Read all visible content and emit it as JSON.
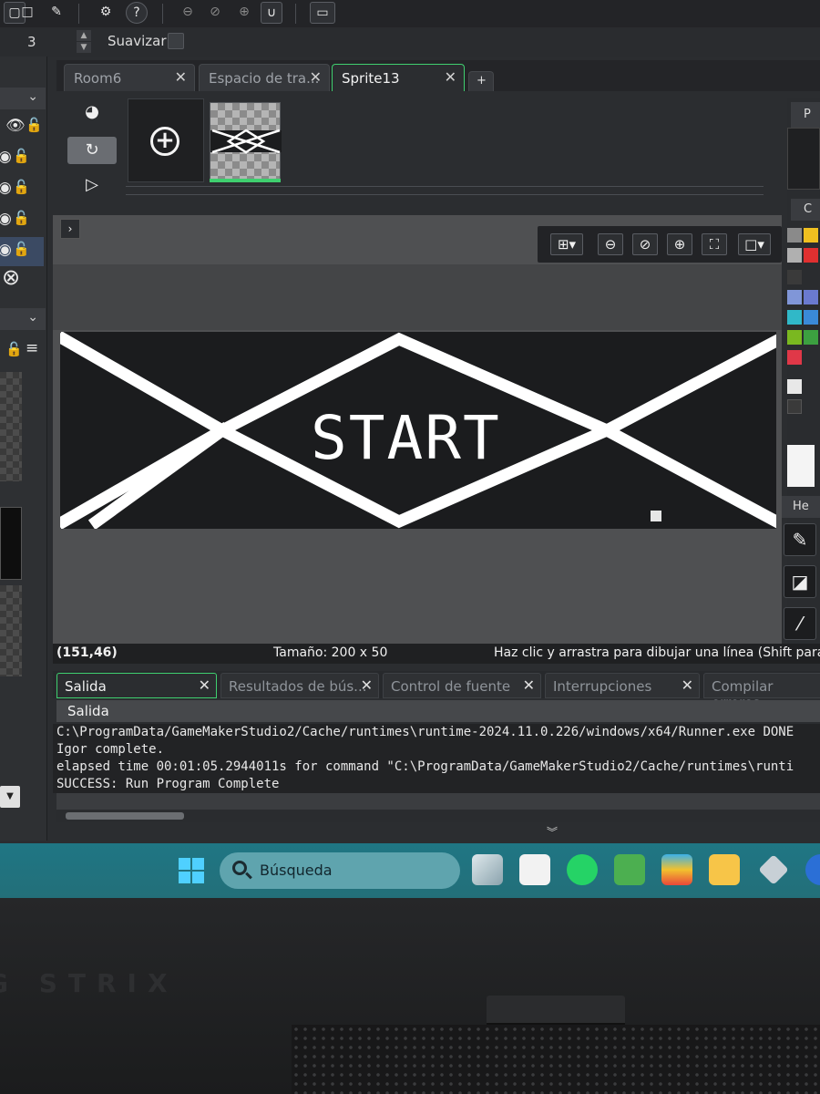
{
  "toolbar": {
    "brush_size": "3",
    "smooth_label": "Suavizar"
  },
  "tabs": [
    {
      "label": "Room6"
    },
    {
      "label": "Espacio de tra..."
    },
    {
      "label": "Sprite13"
    }
  ],
  "tabs_add": "+",
  "canvas": {
    "sprite_text": "START"
  },
  "status": {
    "coords": "(151,46)",
    "size": "Tamaño: 200 x 50",
    "hint": "Haz clic y arrastra para dibujar una línea (Shift para un"
  },
  "output": {
    "tabs": [
      {
        "label": "Salida"
      },
      {
        "label": "Resultados de bús..."
      },
      {
        "label": "Control de fuente"
      },
      {
        "label": "Interrupciones"
      },
      {
        "label": "Compilar errores"
      }
    ],
    "subheader": "Salida",
    "log": [
      "C:\\ProgramData/GameMakerStudio2/Cache/runtimes\\runtime-2024.11.0.226/windows/x64/Runner.exe DONE",
      "Igor complete.",
      "elapsed time 00:01:05.2944011s for command \"C:\\ProgramData/GameMakerStudio2/Cache/runtimes\\runti",
      "SUCCESS: Run Program Complete"
    ]
  },
  "taskbar": {
    "search_placeholder": "Búsqueda"
  },
  "device": {
    "brand": "G STRIX"
  },
  "colors": {
    "accent_green": "#3fcf6f",
    "taskbar": "#1f7684"
  },
  "icons": [
    "settings-icon",
    "help-icon",
    "zoom-out-icon",
    "zoom-in-icon",
    "grid-icon",
    "eye-icon",
    "lock-icon",
    "plus-circle-icon",
    "play-icon",
    "pencil-icon",
    "eyedropper-icon",
    "search-icon",
    "windows-start-icon"
  ]
}
